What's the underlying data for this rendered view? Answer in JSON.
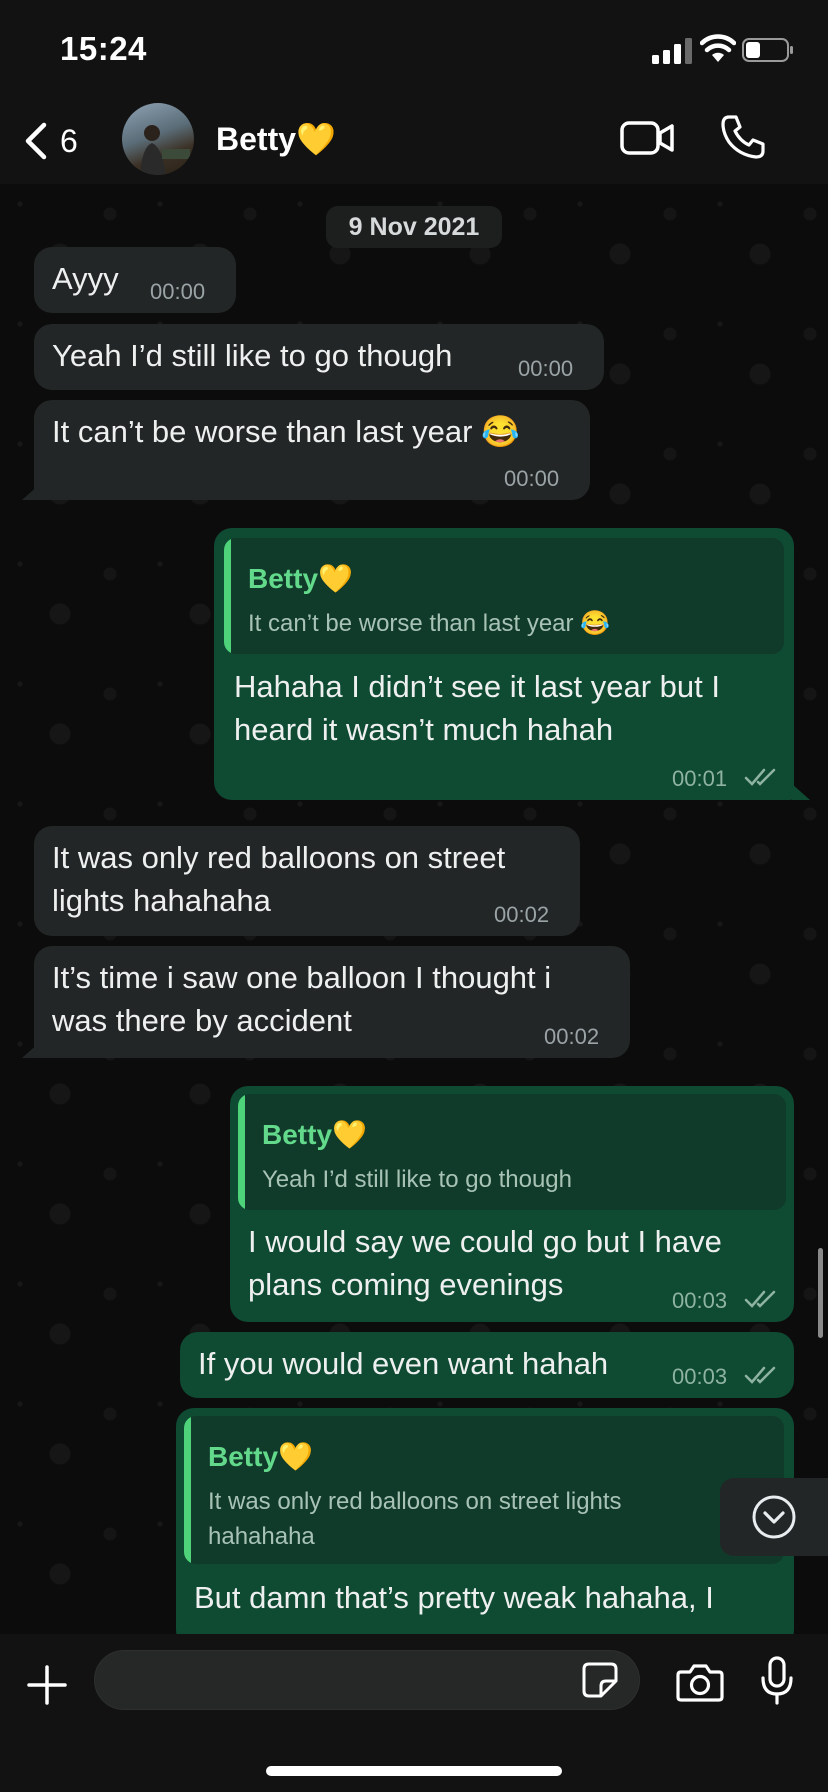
{
  "status_bar": {
    "time": "15:24"
  },
  "header": {
    "back_count": "6",
    "contact_name": "Betty💛"
  },
  "chat": {
    "date": "9 Nov 2021",
    "messages": [
      {
        "direction": "in",
        "text": "Ayyy",
        "time": "00:00"
      },
      {
        "direction": "in",
        "text": "Yeah I’d still like to go though",
        "time": "00:00"
      },
      {
        "direction": "in",
        "text": "It can’t be worse than last year 😂",
        "time": "00:00"
      },
      {
        "direction": "out",
        "quote_author": "Betty💛",
        "quote_text": "It can’t be worse than last year 😂",
        "text_line1": "Hahaha I didn’t see it last year but I",
        "text_line2": "heard it wasn’t much hahah",
        "time": "00:01"
      },
      {
        "direction": "in",
        "text_line1": "It was only red balloons on street",
        "text_line2": "lights hahahaha",
        "time": "00:02"
      },
      {
        "direction": "in",
        "text_line1": "It’s time i saw one balloon I thought i",
        "text_line2": "was there by accident",
        "time": "00:02"
      },
      {
        "direction": "out",
        "quote_author": "Betty💛",
        "quote_text": "Yeah I’d still like to go though",
        "text_line1": "I would say we could go but I have",
        "text_line2": "plans coming evenings",
        "time": "00:03"
      },
      {
        "direction": "out",
        "text": "If you would even want hahah",
        "time": "00:03"
      },
      {
        "direction": "out",
        "quote_author": "Betty💛",
        "quote_text_line1": "It was only red balloons on street lights",
        "quote_text_line2": "hahahaha",
        "text_line1": "But damn that’s pretty weak hahaha, I"
      }
    ]
  },
  "colors": {
    "incoming_bubble": "#232626",
    "outgoing_bubble": "#0f4a33",
    "quote_accent": "#4ed37a"
  },
  "icons": [
    "back-chevron-icon",
    "video-call-icon",
    "phone-icon",
    "plus-icon",
    "sticker-icon",
    "camera-icon",
    "microphone-icon",
    "chevron-down-icon",
    "double-check-icon"
  ]
}
